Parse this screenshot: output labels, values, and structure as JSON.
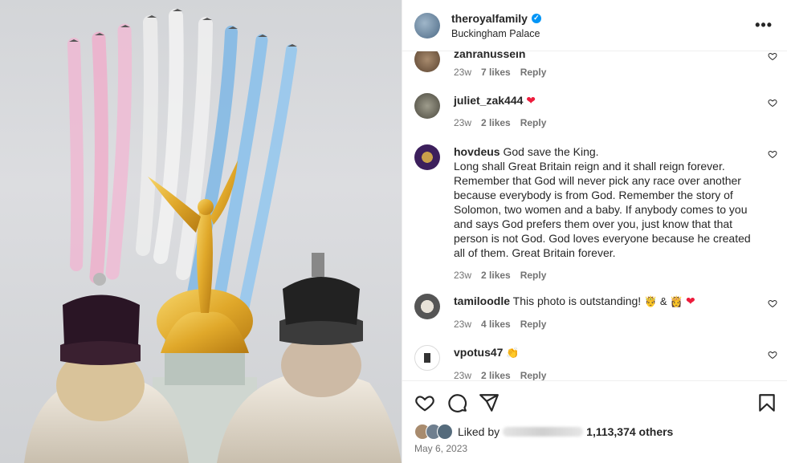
{
  "header": {
    "username": "theroyalfamily",
    "location": "Buckingham Palace",
    "more_label": "•••"
  },
  "comments": [
    {
      "username": "zahrahussein",
      "text": "",
      "age": "23w",
      "likes": "7 likes",
      "reply": "Reply"
    },
    {
      "username": "juliet_zak444",
      "text": "",
      "age": "23w",
      "likes": "2 likes",
      "reply": "Reply"
    },
    {
      "username": "hovdeus",
      "text": "God save the King.\nLong shall Great Britain reign and it shall reign forever. Remember that God will never pick any race over another because everybody is from God. Remember the story of Solomon, two women and a baby. If anybody comes to you and says God prefers them over you, just know that that person is not God. God loves everyone because he created all of them. Great Britain forever.",
      "age": "23w",
      "likes": "2 likes",
      "reply": "Reply"
    },
    {
      "username": "tamiloodle",
      "text": "This photo is outstanding!",
      "age": "23w",
      "likes": "4 likes",
      "reply": "Reply"
    },
    {
      "username": "vpotus47",
      "text": "",
      "age": "23w",
      "likes": "2 likes",
      "reply": "Reply"
    }
  ],
  "likes": {
    "prefix": "Liked by",
    "count": "1,113,374 others"
  },
  "date": "May 6, 2023",
  "icons": [
    "verified-badge-icon",
    "more-icon",
    "heart-icon",
    "comment-icon",
    "share-icon",
    "bookmark-icon"
  ],
  "colors": {
    "accent": "#0095f6",
    "heart": "#ed1c3c",
    "muted": "#737373"
  }
}
